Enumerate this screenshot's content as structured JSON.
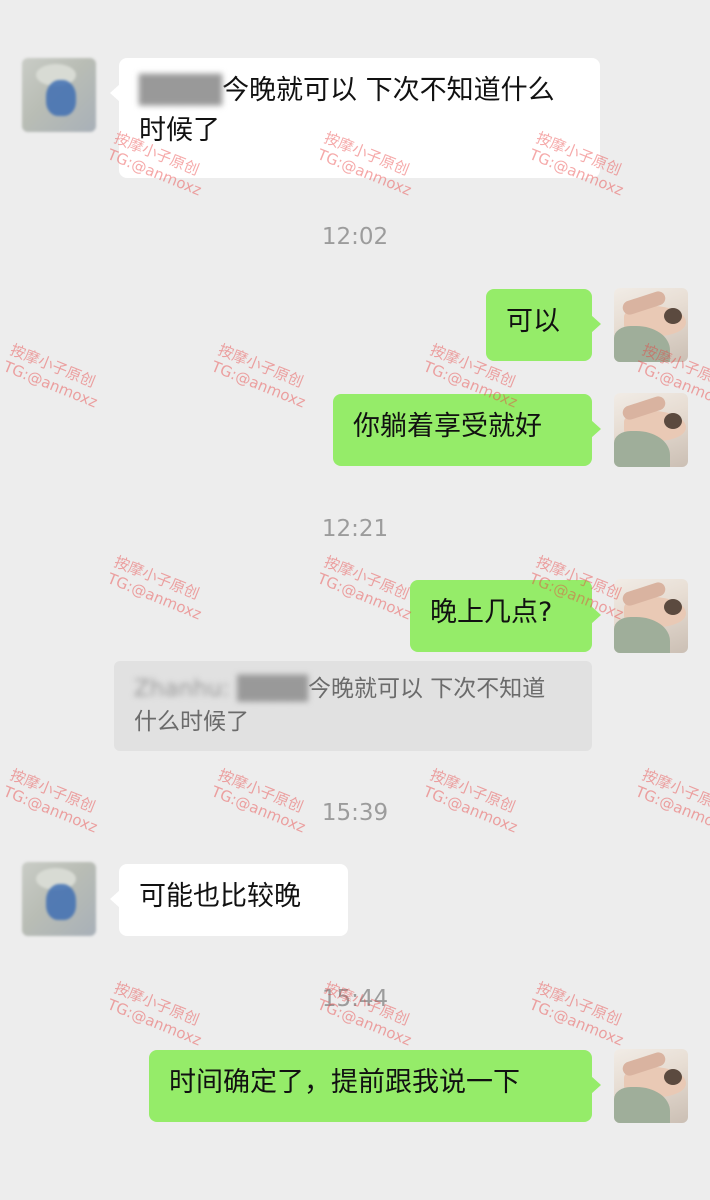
{
  "messages": [
    {
      "side": "in",
      "blurred_prefix": "████",
      "text_line1": "今晚就可以 下次不知道什么",
      "text_line2": "时候了"
    },
    {
      "side": "time",
      "text": "12:02"
    },
    {
      "side": "out",
      "text": "可以"
    },
    {
      "side": "out",
      "text": "你躺着享受就好"
    },
    {
      "side": "time",
      "text": "12:21"
    },
    {
      "side": "out",
      "text": "晚上几点?"
    },
    {
      "side": "quote",
      "blurred_prefix": "Zhanhu: ████",
      "text_line1": "今晚就可以 下次不知道",
      "text_line2": "什么时候了"
    },
    {
      "side": "time",
      "text": "15:39"
    },
    {
      "side": "in",
      "text": "可能也比较晚"
    },
    {
      "side": "time",
      "text": "15:44"
    },
    {
      "side": "out",
      "text": "时间确定了，提前跟我说一下"
    }
  ],
  "watermark": {
    "line1": "按摩小子原创",
    "line2": "TG:@anmoxz",
    "color": "#e84040"
  },
  "colors": {
    "background": "#ededed",
    "outgoing_bubble": "#95ec69",
    "incoming_bubble": "#ffffff",
    "timestamp": "#9c9c9c"
  }
}
